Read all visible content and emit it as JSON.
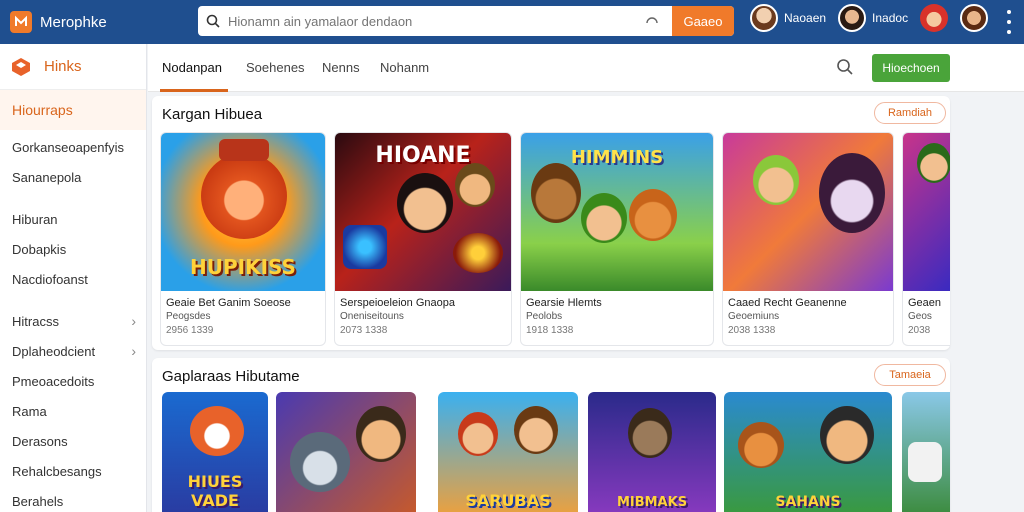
{
  "app": {
    "brand": "Merophke"
  },
  "search": {
    "placeholder": "Hionamn ain yamalaor dendaon",
    "button_label": "Gaaeo"
  },
  "users": [
    {
      "name": "Naoaen"
    },
    {
      "name": "Inadoc"
    }
  ],
  "sidebar": {
    "header": "Hinks",
    "items": [
      {
        "label": "Hiourraps",
        "active": true
      },
      {
        "label": "Gorkanseoapenfyis"
      },
      {
        "label": "Sananepola"
      },
      {
        "label": "Hiburan"
      },
      {
        "label": "Dobapkis"
      },
      {
        "label": "Nacdiofoanst"
      },
      {
        "label": "Hitracss",
        "chevron": true
      },
      {
        "label": "Dplaheodcient",
        "chevron": true
      },
      {
        "label": "Pmeoacedoits"
      },
      {
        "label": "Rama"
      },
      {
        "label": "Derasons"
      },
      {
        "label": "Rehalcbesangs"
      },
      {
        "label": "Berahels"
      }
    ]
  },
  "tabs": [
    {
      "label": "Nodanpan",
      "active": true
    },
    {
      "label": "Soehenes"
    },
    {
      "label": "Nenns"
    },
    {
      "label": "Nohanm"
    }
  ],
  "toolbar": {
    "button_label": "Hioechoen"
  },
  "section1": {
    "title": "Kargan Hibuea",
    "more_label": "Ramdiah",
    "cards": [
      {
        "name": "Geaie Bet Ganim Soeose",
        "sub": "Peogsdes",
        "num": "2956 1339",
        "art": "HUPIKISS"
      },
      {
        "name": "Serspeioeleion Gnaopa",
        "sub": "Oneniseitouns",
        "num": "2073 1338",
        "art": "HIOANE"
      },
      {
        "name": "Gearsie Hlemts",
        "sub": "Peolobs",
        "num": "1918 1338",
        "art": "HIMMINS"
      },
      {
        "name": "Caaed Recht Geanenne",
        "sub": "Geoemiuns",
        "num": "2038 1338",
        "art": ""
      },
      {
        "name": "Geaen",
        "sub": "Geos",
        "num": "2038",
        "art": ""
      }
    ]
  },
  "section2": {
    "title": "Gaplaraas Hibutame",
    "more_label": "Tamaeia",
    "cards": [
      {
        "art": "HIUES VADE"
      },
      {
        "art": ""
      },
      {
        "art": "SARUBAS"
      },
      {
        "art": "MIBMAKS"
      },
      {
        "art": "SAHANS"
      },
      {
        "art": ""
      }
    ]
  },
  "colors": {
    "topbar": "#1f4f8f",
    "accent": "#d9651c",
    "green_button": "#4aa43a"
  }
}
